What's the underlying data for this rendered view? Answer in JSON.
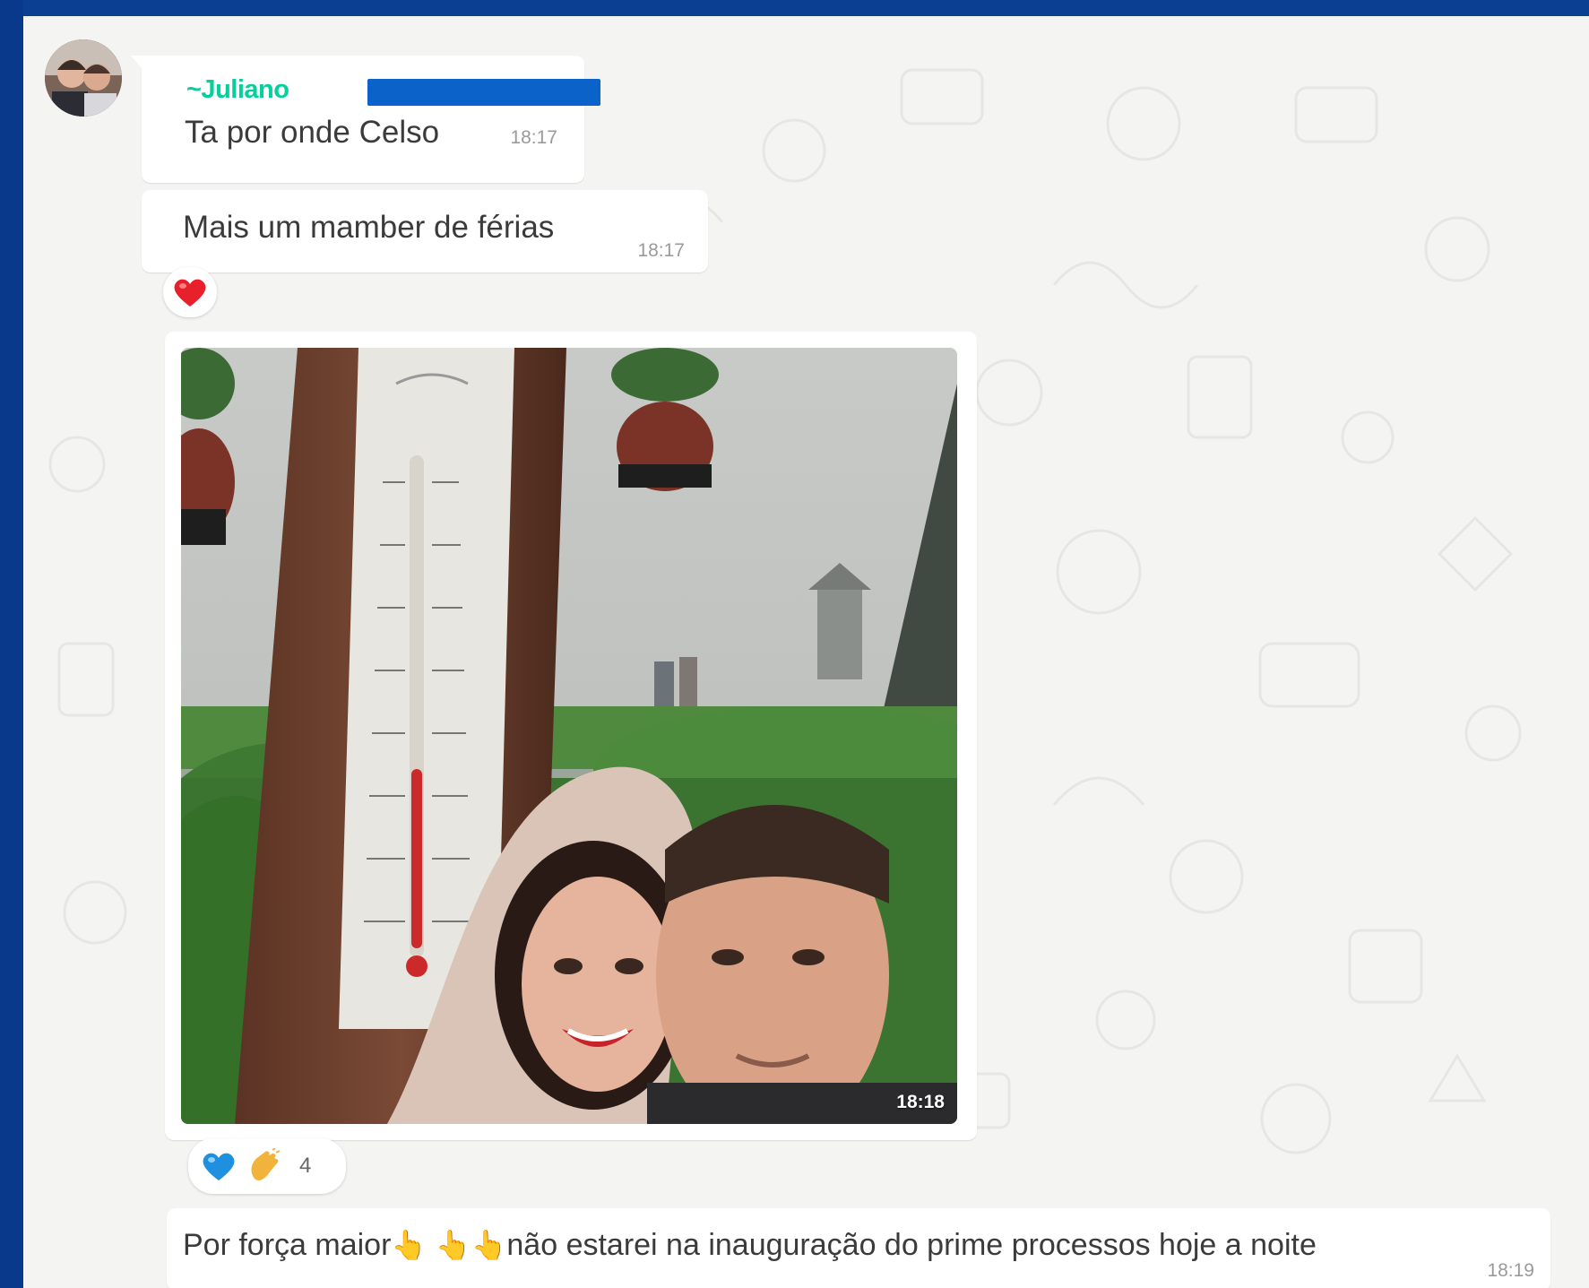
{
  "messages": [
    {
      "sender": "~Juliano",
      "text": "Ta por onde Celso",
      "time": "18:17"
    },
    {
      "text": "Mais um mamber de férias",
      "time": "18:17",
      "reaction": "heart-red"
    },
    {
      "type": "image",
      "time": "18:18",
      "reactions": [
        "heart-blue",
        "clapping-hands"
      ],
      "reaction_count": "4"
    },
    {
      "text_parts": [
        "Por força maior",
        "👆",
        " ",
        "👆",
        "👆",
        "não estarei na inauguração do prime processos hoje a noite"
      ],
      "time": "18:19"
    }
  ],
  "colors": {
    "sender_name": "#06cf9c",
    "bubble_bg": "#ffffff",
    "chat_bg": "#f4f4f2",
    "frame": "#0a3f91",
    "redaction": "#0b63c9"
  }
}
